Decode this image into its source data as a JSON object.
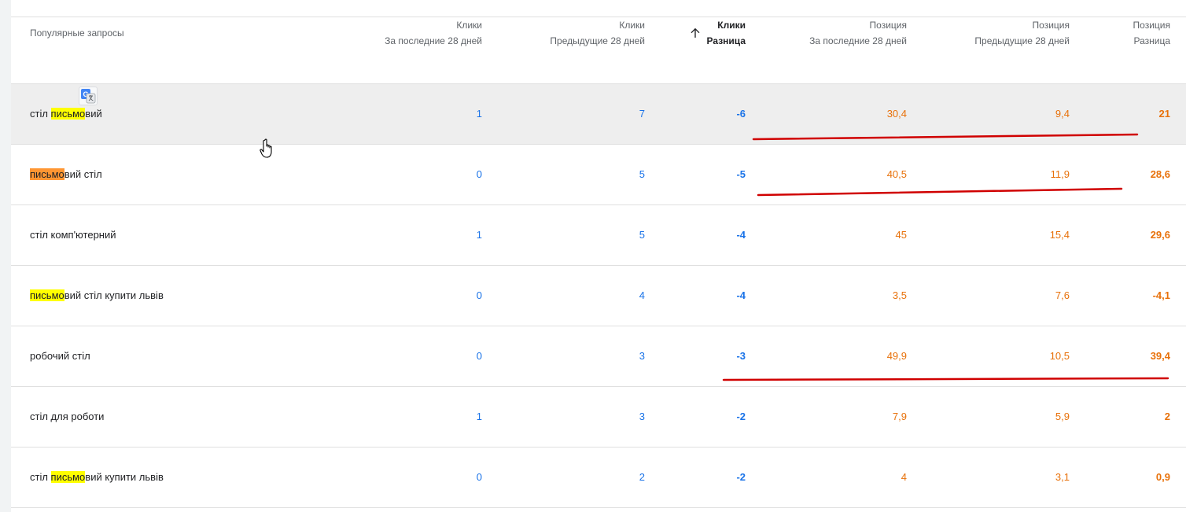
{
  "table": {
    "headers": {
      "query": "Популярные запросы",
      "clicks_last": [
        "Клики",
        "За последние 28 дней"
      ],
      "clicks_prev": [
        "Клики",
        "Предыдущие 28 дней"
      ],
      "clicks_diff": [
        "Клики",
        "Разница"
      ],
      "pos_last": [
        "Позиция",
        "За последние 28 дней"
      ],
      "pos_prev": [
        "Позиция",
        "Предыдущие 28 дней"
      ],
      "pos_diff": [
        "Позиция",
        "Разница"
      ]
    },
    "rows": [
      {
        "q_pre": "стіл ",
        "q_hl": "письмо",
        "q_post": "вий",
        "hl_color": "yellow",
        "clicks_last": "1",
        "clicks_prev": "7",
        "clicks_diff": "-6",
        "pos_last": "30,4",
        "pos_prev": "9,4",
        "pos_diff": "21"
      },
      {
        "q_pre": "",
        "q_hl": "письмо",
        "q_post": "вий стіл",
        "hl_color": "orange",
        "clicks_last": "0",
        "clicks_prev": "5",
        "clicks_diff": "-5",
        "pos_last": "40,5",
        "pos_prev": "11,9",
        "pos_diff": "28,6"
      },
      {
        "q_pre": "стіл комп'ютерний",
        "q_hl": "",
        "q_post": "",
        "hl_color": "",
        "clicks_last": "1",
        "clicks_prev": "5",
        "clicks_diff": "-4",
        "pos_last": "45",
        "pos_prev": "15,4",
        "pos_diff": "29,6"
      },
      {
        "q_pre": "",
        "q_hl": "письмо",
        "q_post": "вий стіл купити львів",
        "hl_color": "yellow",
        "clicks_last": "0",
        "clicks_prev": "4",
        "clicks_diff": "-4",
        "pos_last": "3,5",
        "pos_prev": "7,6",
        "pos_diff": "-4,1"
      },
      {
        "q_pre": "робочий стіл",
        "q_hl": "",
        "q_post": "",
        "hl_color": "",
        "clicks_last": "0",
        "clicks_prev": "3",
        "clicks_diff": "-3",
        "pos_last": "49,9",
        "pos_prev": "10,5",
        "pos_diff": "39,4"
      },
      {
        "q_pre": "стіл для роботи",
        "q_hl": "",
        "q_post": "",
        "hl_color": "",
        "clicks_last": "1",
        "clicks_prev": "3",
        "clicks_diff": "-2",
        "pos_last": "7,9",
        "pos_prev": "5,9",
        "pos_diff": "2"
      },
      {
        "q_pre": "стіл ",
        "q_hl": "письмо",
        "q_post": "вий купити львів",
        "hl_color": "yellow",
        "clicks_last": "0",
        "clicks_prev": "2",
        "clicks_diff": "-2",
        "pos_last": "4",
        "pos_prev": "3,1",
        "pos_diff": "0,9"
      }
    ]
  },
  "icons": {
    "sort": "arrow-upward-icon",
    "translate": "google-translate-icon",
    "cursor": "hand-pointer-cursor"
  },
  "colors": {
    "clicks": "#1a73e8",
    "position": "#e8710a",
    "hover_row": "#eeeeee",
    "highlight_yellow": "#ffff00",
    "highlight_orange": "#ff9632",
    "annotation_red": "#d00000"
  }
}
